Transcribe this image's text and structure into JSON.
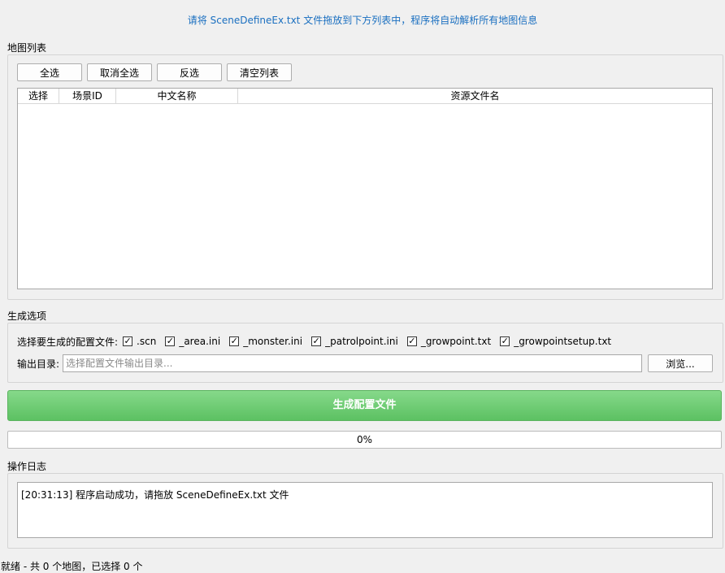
{
  "hint": "请将 SceneDefineEx.txt 文件拖放到下方列表中，程序将自动解析所有地图信息",
  "map_list": {
    "title": "地图列表",
    "buttons": {
      "select_all": "全选",
      "deselect_all": "取消全选",
      "invert": "反选",
      "clear": "清空列表"
    },
    "columns": [
      "选择",
      "场景ID",
      "中文名称",
      "资源文件名"
    ],
    "rows": []
  },
  "options": {
    "title": "生成选项",
    "config_label": "选择要生成的配置文件:",
    "files": [
      {
        "label": ".scn",
        "checked": true
      },
      {
        "label": "_area.ini",
        "checked": true
      },
      {
        "label": "_monster.ini",
        "checked": true
      },
      {
        "label": "_patrolpoint.ini",
        "checked": true
      },
      {
        "label": "_growpoint.txt",
        "checked": true
      },
      {
        "label": "_growpointsetup.txt",
        "checked": true
      }
    ],
    "output_label": "输出目录:",
    "output_value": "",
    "output_placeholder": "选择配置文件输出目录...",
    "browse": "浏览..."
  },
  "generate_button": "生成配置文件",
  "progress": {
    "value": 0,
    "text": "0%"
  },
  "log": {
    "title": "操作日志",
    "lines": [
      "[20:31:13] 程序启动成功，请拖放 SceneDefineEx.txt 文件"
    ]
  },
  "status_bar": "就绪 - 共 0 个地图，已选择 0 个",
  "colors": {
    "hint": "#1a6fc0",
    "generate_bg": "#6fcb73",
    "progress_fill": "#06b025"
  }
}
